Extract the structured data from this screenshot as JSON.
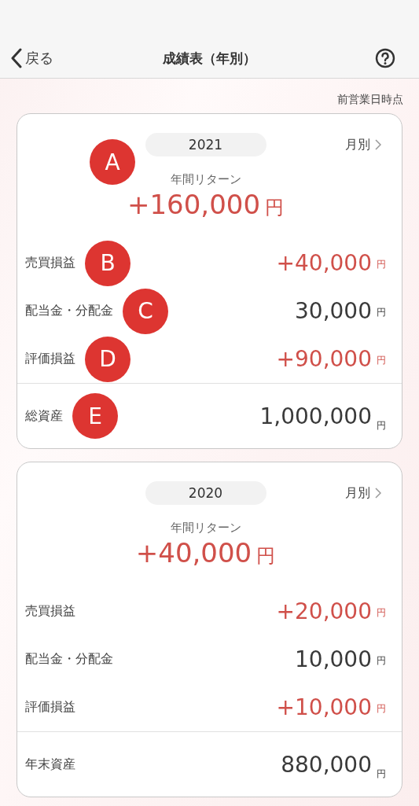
{
  "nav": {
    "back": "戻る",
    "title": "成績表（年別）"
  },
  "as_of": "前営業日時点",
  "cards": [
    {
      "year": "2021",
      "monthly": "月別",
      "annual_return": {
        "label": "年間リターン",
        "value": "+160,000",
        "unit": "円",
        "color": "#d0504a",
        "marker": "A"
      },
      "rows": [
        {
          "label": "売買損益",
          "value": "+40,000",
          "unit": "円",
          "color": "#d0504a",
          "marker": "B"
        },
        {
          "label": "配当金・分配金",
          "value": "30,000",
          "unit": "円",
          "color": "#3a3a3a",
          "marker": "C"
        },
        {
          "label": "評価損益",
          "value": "+90,000",
          "unit": "円",
          "color": "#d0504a",
          "marker": "D"
        }
      ],
      "total": {
        "label": "総資産",
        "value": "1,000,000",
        "unit": "円",
        "color": "#3a3a3a",
        "marker": "E"
      }
    },
    {
      "year": "2020",
      "monthly": "月別",
      "annual_return": {
        "label": "年間リターン",
        "value": "+40,000",
        "unit": "円",
        "color": "#d0504a"
      },
      "rows": [
        {
          "label": "売買損益",
          "value": "+20,000",
          "unit": "円",
          "color": "#d0504a"
        },
        {
          "label": "配当金・分配金",
          "value": "10,000",
          "unit": "円",
          "color": "#3a3a3a"
        },
        {
          "label": "評価損益",
          "value": "+10,000",
          "unit": "円",
          "color": "#d0504a"
        }
      ],
      "total": {
        "label": "年末資産",
        "value": "880,000",
        "unit": "円",
        "color": "#3a3a3a"
      }
    }
  ]
}
